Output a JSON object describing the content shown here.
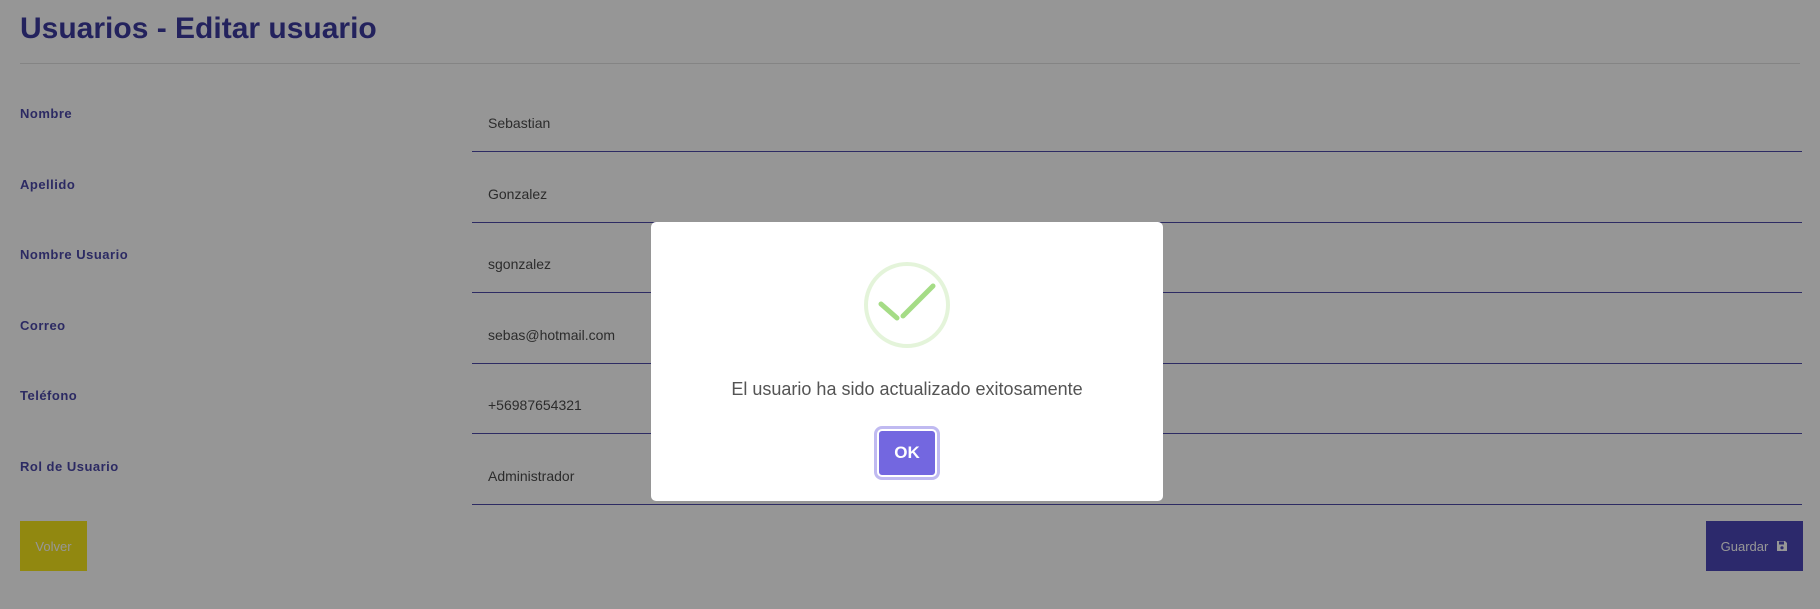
{
  "page": {
    "title": "Usuarios - Editar usuario"
  },
  "form": {
    "fields": [
      {
        "label": "Nombre",
        "value": "Sebastian"
      },
      {
        "label": "Apellido",
        "value": "Gonzalez"
      },
      {
        "label": "Nombre Usuario",
        "value": "sgonzalez"
      },
      {
        "label": "Correo",
        "value": "sebas@hotmail.com"
      },
      {
        "label": "Teléfono",
        "value": "+56987654321"
      },
      {
        "label": "Rol de Usuario",
        "value": "Administrador"
      }
    ],
    "back_label": "Volver",
    "save_label": "Guardar",
    "save_icon": "save-icon"
  },
  "dialog": {
    "icon": "success-check-icon",
    "message": "El usuario ha sido actualizado exitosamente",
    "ok_label": "OK"
  },
  "colors": {
    "title": "#3d3a9e",
    "primary": "#4c46b8",
    "back_button": "#f6e71c",
    "ok_button": "#7367e0",
    "success": "#a5dc86"
  }
}
